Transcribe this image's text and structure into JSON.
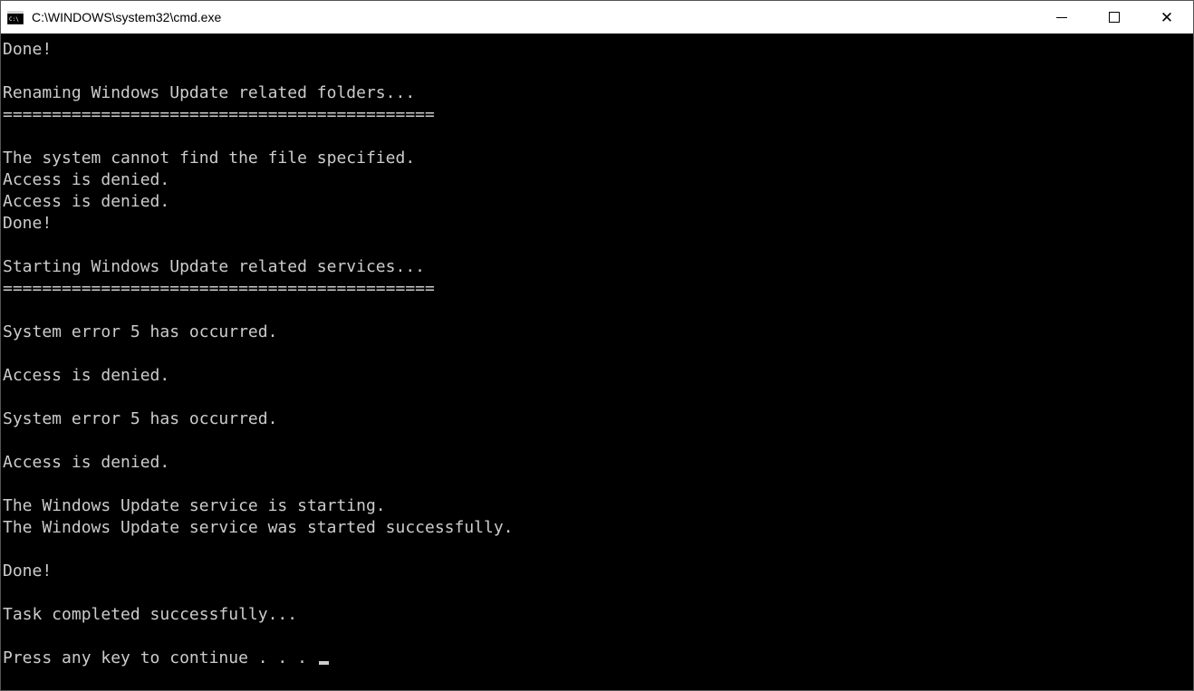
{
  "window": {
    "title": "C:\\WINDOWS\\system32\\cmd.exe"
  },
  "console": {
    "lines": [
      "Done!",
      "",
      "Renaming Windows Update related folders...",
      "============================================",
      "",
      "The system cannot find the file specified.",
      "Access is denied.",
      "Access is denied.",
      "Done!",
      "",
      "Starting Windows Update related services...",
      "============================================",
      "",
      "System error 5 has occurred.",
      "",
      "Access is denied.",
      "",
      "System error 5 has occurred.",
      "",
      "Access is denied.",
      "",
      "The Windows Update service is starting.",
      "The Windows Update service was started successfully.",
      "",
      "Done!",
      "",
      "Task completed successfully...",
      "",
      "Press any key to continue . . . "
    ]
  }
}
